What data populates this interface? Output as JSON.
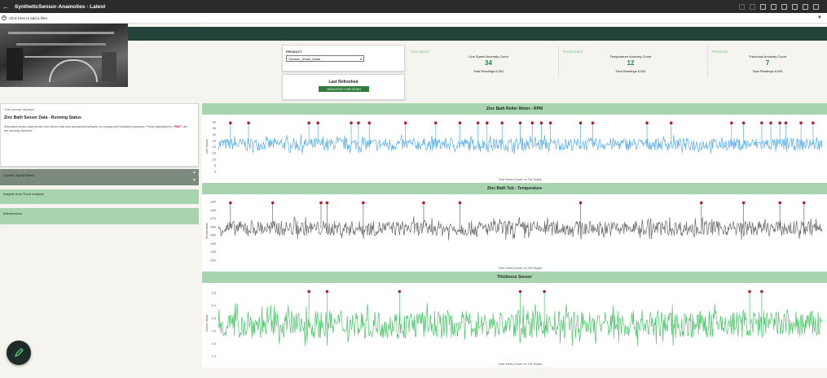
{
  "window": {
    "title": "SyntheticSensor-Anamolies - Latest"
  },
  "filterbar": {
    "add_filter_text": "Click here to add a filter"
  },
  "product": {
    "label": "PRODUCT",
    "selected": "Outdoor_Sheet_Metal"
  },
  "last_refreshed": {
    "label": "Last Refreshed",
    "value": "06/24/2024 9:53:33 AM"
  },
  "kpis": [
    {
      "title": "Line Speed",
      "count_label": "Line Speed Anomaly Count",
      "count": "34",
      "total_label": "Total Readings",
      "total": "6,081"
    },
    {
      "title": "Temperature",
      "count_label": "Temperature Anomaly Count",
      "count": "12",
      "total_label": "Total Readings",
      "total": "6,081"
    },
    {
      "title": "Thickness",
      "count_label": "Thickness Anomaly Count",
      "count": "7",
      "total_label": "Total Readings",
      "total": "6,081"
    }
  ],
  "info": {
    "caption": "This canvas displays",
    "heading": "Zinc Bath Sensor  Data - Running Status",
    "description": "Simulated sensor data stream that mimics real-time operational behavior for training and validation purposes. Points highlighted in",
    "highlight": "\"RED\"",
    "description2": "are the anomaly detected"
  },
  "side_panels": {
    "current_signal_status": "Current Signal Status",
    "insights": "Insights from Trend analysis",
    "maintenance": "Maintenance"
  },
  "colors": {
    "chart1_line": "#5aaee6",
    "chart2_line": "#6a6a6a",
    "chart3_line": "#4cc46a",
    "anomaly": "#b3202a",
    "header_green": "#a7d3ae",
    "banner": "#24433a"
  },
  "charts": [
    {
      "title": "Zinc Bath Roller Motor - RPM",
      "xlabel": "Time Series (Hover on The Graph)",
      "ylabel": "Line Speed",
      "ticks": [
        "40",
        "35",
        "30",
        "25",
        "20",
        "15",
        "10",
        "5",
        "0"
      ],
      "ylim": [
        0,
        40
      ],
      "baseline": 22,
      "noise": 5,
      "anomalies": [
        0.02,
        0.05,
        0.15,
        0.165,
        0.22,
        0.232,
        0.25,
        0.31,
        0.36,
        0.4,
        0.43,
        0.445,
        0.47,
        0.5,
        0.52,
        0.535,
        0.55,
        0.6,
        0.62,
        0.71,
        0.75,
        0.85,
        0.87,
        0.9,
        0.915,
        0.93,
        0.94,
        0.965,
        0.985
      ]
    },
    {
      "title": "Zinc Bath Tub - Temperature",
      "xlabel": "Time Series (Hover on The Graph)",
      "ylabel": "Temperature",
      "ticks": [
        "490",
        "480",
        "470",
        "460",
        "450",
        "440",
        "430",
        "420"
      ],
      "ylim": [
        420,
        490
      ],
      "baseline": 458,
      "noise": 9,
      "anomalies": [
        0.02,
        0.09,
        0.17,
        0.18,
        0.24,
        0.34,
        0.4,
        0.6,
        0.8,
        0.87,
        0.93,
        0.97
      ]
    },
    {
      "title": "Thickness Sensor",
      "xlabel": "Time Series (Hover on The Graph)",
      "ylabel": "Sensor Value",
      "ticks": [
        "3.5",
        "3.0",
        "2.5",
        "2.0",
        "1.5",
        "1.0"
      ],
      "ylim": [
        1.0,
        3.6
      ],
      "baseline": 2.25,
      "noise": 0.55,
      "anomalies": [
        0.15,
        0.18,
        0.3,
        0.5,
        0.54,
        0.88,
        0.9
      ]
    }
  ]
}
